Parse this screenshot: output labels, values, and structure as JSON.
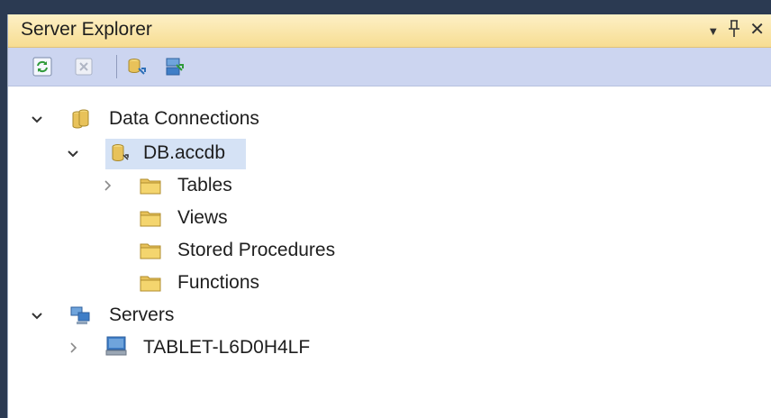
{
  "panel": {
    "title": "Server Explorer",
    "buttons": {
      "dropdown": "▼",
      "pin": "ꟷ",
      "close": "✕"
    }
  },
  "toolbar": {
    "items": [
      "refresh-icon",
      "stop-refresh-icon",
      "connect-to-database-icon",
      "connect-to-server-icon"
    ]
  },
  "tree": {
    "data_connections": "Data Connections",
    "db": "DB.accdb",
    "tables": "Tables",
    "views": "Views",
    "stored_procedures": "Stored Procedures",
    "functions": "Functions",
    "servers": "Servers",
    "tablet": "TABLET-L6D0H4LF"
  },
  "colors": {
    "title_bg": "#f7dd92",
    "toolbar_bg": "#ccd5f0",
    "selection": "#d5e2f5",
    "folder": "#e8c25a"
  }
}
